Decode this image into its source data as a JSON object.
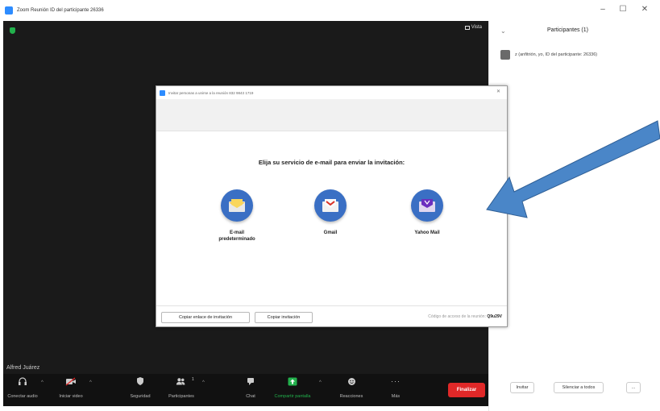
{
  "window": {
    "title": "Zoom Reunión ID del participante 26336",
    "controls": {
      "minimize": "–",
      "maximize": "☐",
      "close": "✕"
    }
  },
  "video": {
    "view_label": "Vista",
    "participant_name": "Alfred Juárez"
  },
  "toolbar": {
    "items": [
      {
        "icon": "headphones-icon",
        "label": "Conectar audio"
      },
      {
        "icon": "video-off-icon",
        "label": "Iniciar video"
      },
      {
        "icon": "shield-icon",
        "label": "Seguridad"
      },
      {
        "icon": "participants-icon",
        "label": "Participantes",
        "count": "1"
      },
      {
        "icon": "chat-icon",
        "label": "Chat"
      },
      {
        "icon": "share-screen-icon",
        "label": "Compartir pantalla"
      },
      {
        "icon": "reactions-icon",
        "label": "Reacciones"
      },
      {
        "icon": "more-icon",
        "label": "Más"
      }
    ],
    "end_label": "Finalizar",
    "colors": {
      "share": "#22b14c",
      "end": "#e02828"
    }
  },
  "panel": {
    "collapse": "⌄",
    "title": "Participantes (1)",
    "participants": [
      {
        "name": "z (anfitrión, yo, ID del participante: 26336)"
      }
    ],
    "footer": {
      "invite": "Invitar",
      "mute_all": "Silenciar a todos",
      "more": "..."
    }
  },
  "dialog": {
    "title": "Invitar personas a unirse a la reunión 832 9843 1719",
    "close": "✕",
    "heading": "Elija su servicio de e-mail para enviar la invitación:",
    "services": [
      {
        "label": "E-mail\npredeterminado",
        "icon": "default-email-icon"
      },
      {
        "label": "Gmail",
        "icon": "gmail-icon"
      },
      {
        "label": "Yahoo Mail",
        "icon": "yahoo-mail-icon"
      }
    ],
    "copy_link": "Copiar enlace de invitación",
    "copy_invite": "Copiar invitación",
    "meeting_code_label": "Código de acceso de la reunión:",
    "meeting_code": "Q9u29V"
  },
  "annotation": {
    "color": "#4a86c8"
  }
}
